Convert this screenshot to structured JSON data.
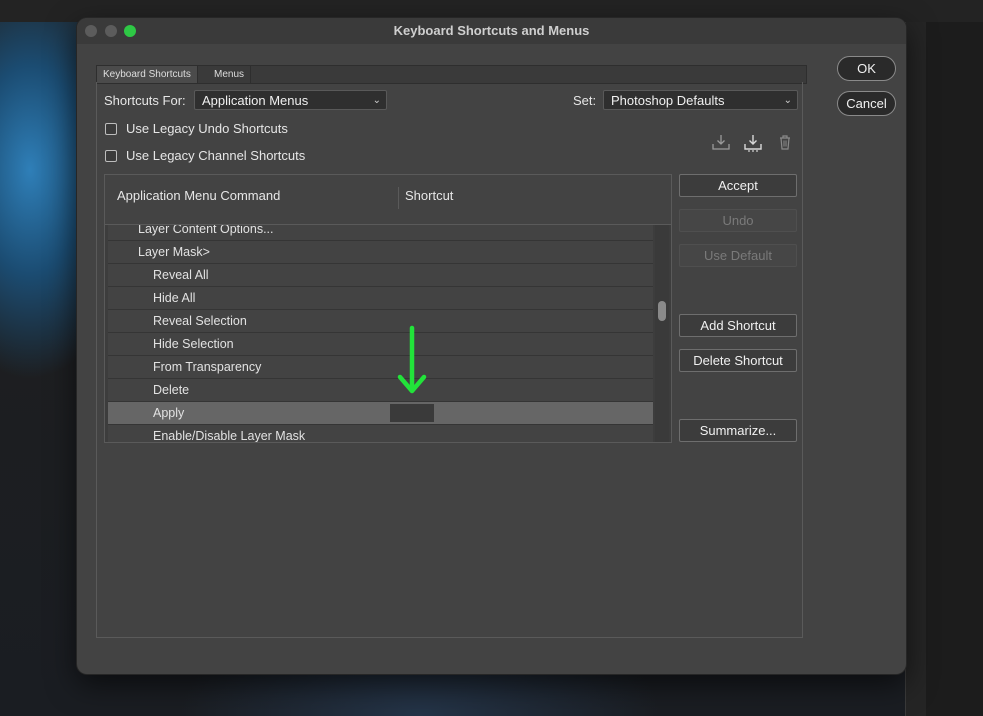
{
  "dialog": {
    "title": "Keyboard Shortcuts and Menus",
    "tabs": [
      {
        "label": "Keyboard Shortcuts",
        "active": true
      },
      {
        "label": "Menus",
        "active": false
      }
    ],
    "shortcuts_for_label": "Shortcuts For:",
    "shortcuts_for_value": "Application Menus",
    "set_label": "Set:",
    "set_value": "Photoshop Defaults",
    "checkboxes": [
      {
        "label": "Use Legacy Undo Shortcuts",
        "checked": false
      },
      {
        "label": "Use Legacy Channel Shortcuts",
        "checked": false
      }
    ],
    "set_icons": [
      "save-set-icon",
      "save-as-new-set-icon",
      "delete-set-icon"
    ],
    "table": {
      "headers": [
        "Application Menu Command",
        "Shortcut"
      ],
      "rows": [
        {
          "label": "Layer Content Options...",
          "level": 1,
          "shortcut": ""
        },
        {
          "label": "Layer Mask>",
          "level": 1,
          "shortcut": ""
        },
        {
          "label": "Reveal All",
          "level": 2,
          "shortcut": ""
        },
        {
          "label": "Hide All",
          "level": 2,
          "shortcut": ""
        },
        {
          "label": "Reveal Selection",
          "level": 2,
          "shortcut": ""
        },
        {
          "label": "Hide Selection",
          "level": 2,
          "shortcut": ""
        },
        {
          "label": "From Transparency",
          "level": 2,
          "shortcut": ""
        },
        {
          "label": "Delete",
          "level": 2,
          "shortcut": ""
        },
        {
          "label": "Apply",
          "level": 2,
          "shortcut": "",
          "selected": true
        },
        {
          "label": "Enable/Disable Layer Mask",
          "level": 2,
          "shortcut": ""
        }
      ]
    },
    "side_buttons": {
      "accept": "Accept",
      "undo": "Undo",
      "use_default": "Use Default",
      "add_shortcut": "Add Shortcut",
      "delete_shortcut": "Delete Shortcut",
      "summarize": "Summarize..."
    },
    "ok": "OK",
    "cancel": "Cancel",
    "colors": {
      "dialog_bg": "#434343",
      "selected_row": "#666666",
      "annotation_arrow": "#22e33a",
      "zoom_button": "#2ec845"
    }
  }
}
